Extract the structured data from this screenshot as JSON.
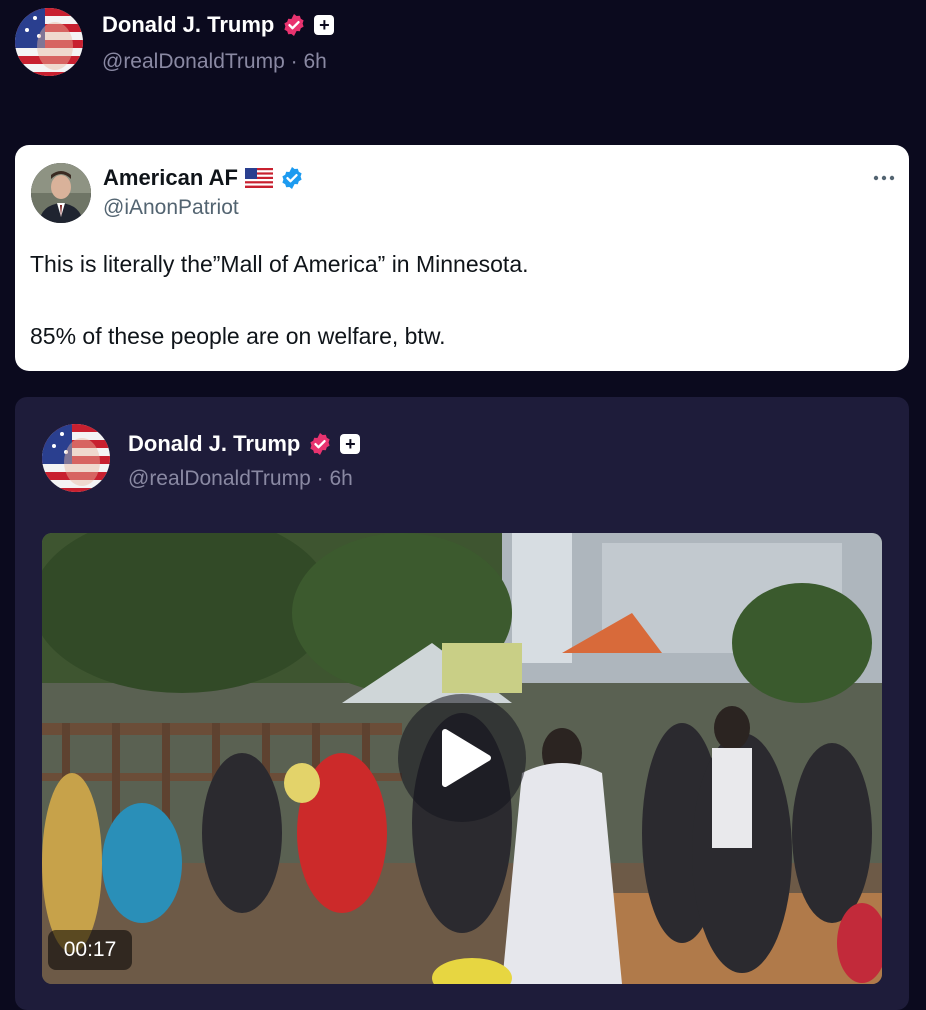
{
  "post": {
    "author_name": "Donald J. Trump",
    "handle": "@realDonaldTrump",
    "separator": "·",
    "time": "6h"
  },
  "quoted": {
    "author_name": "American AF",
    "flag_emoji": "🇺🇸",
    "handle": "@iAnonPatriot",
    "more_icon": "more-dots-icon",
    "text_line1": "This is literally the”Mall of America” in Minnesota.",
    "text_line2": "85% of these people are on welfare, btw."
  },
  "embedded": {
    "author_name": "Donald J. Trump",
    "handle": "@realDonaldTrump",
    "separator": "·",
    "time": "6h",
    "video_duration": "00:17"
  },
  "colors": {
    "background": "#0b0a1e",
    "verified_pink": "#e8336f",
    "verified_blue": "#1d9bf0",
    "card_dark": "#1e1c3a"
  }
}
